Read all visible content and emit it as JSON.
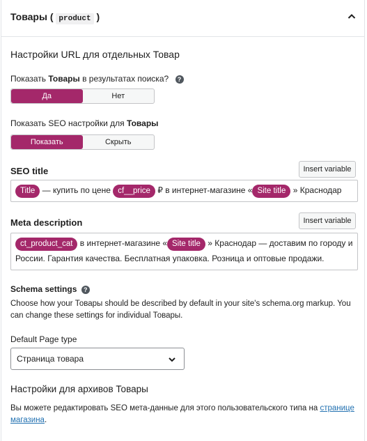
{
  "header": {
    "title": "Товары",
    "paren_open": "(",
    "code": "product",
    "paren_close": ")"
  },
  "url_settings": {
    "heading": "Настройки URL для отдельных Товар"
  },
  "search_toggle": {
    "label_prefix": "Показать",
    "label_bold": "Товары",
    "label_suffix": "в результатах поиска?",
    "yes": "Да",
    "no": "Нет",
    "selected": "Да"
  },
  "seo_toggle": {
    "label_prefix": "Показать SEO настройки для",
    "label_bold": "Товары",
    "show": "Показать",
    "hide": "Скрыть",
    "selected": "Показать"
  },
  "seo_title": {
    "label": "SEO title",
    "insert_button": "Insert variable",
    "var_title": "Title",
    "text1": "— купить по цене",
    "var_price": "cf__price",
    "text2": "₽ в интернет-магазине «",
    "var_site": "Site title",
    "text3": "» Краснодар"
  },
  "meta_description": {
    "label": "Meta description",
    "insert_button": "Insert variable",
    "var_cat": "ct_product_cat",
    "text1": "в интернет-магазине «",
    "var_site": "Site title",
    "text2": "» Краснодар — доставим по городу и",
    "line2": "России. Гарантия качества. Бесплатная упаковка. Розница и оптовые продажи."
  },
  "schema": {
    "label": "Schema settings",
    "description": "Choose how your Товары should be described by default in your site's schema.org markup. You can change these settings for individual Товары."
  },
  "page_type": {
    "label": "Default Page type",
    "selected": "Страница товара"
  },
  "archives": {
    "heading": "Настройки для архивов Товары",
    "text": "Вы можете редактировать SEO мета-данные для этого пользовательского типа на",
    "link": "странице магазина",
    "period": "."
  },
  "colors": {
    "accent": "#a4286a",
    "link": "#2271b1"
  },
  "icons": {
    "collapse": "chevron-up-icon",
    "help": "question-circle-icon",
    "select": "chevron-down-icon"
  }
}
